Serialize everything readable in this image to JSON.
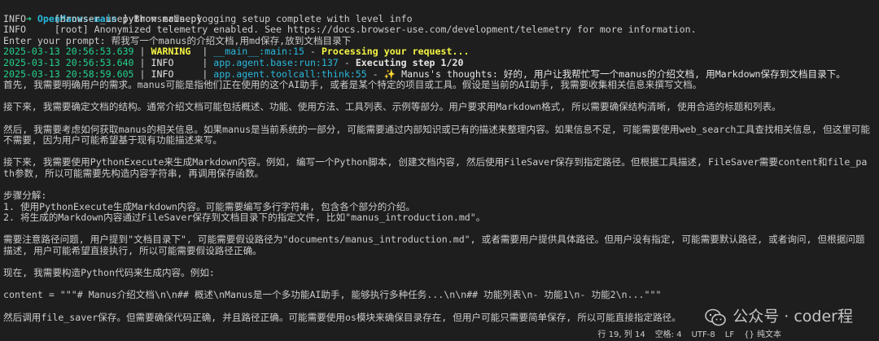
{
  "prompt_line": {
    "arrow": "➜",
    "dir": "OpenManus-main",
    "command": "python main.py"
  },
  "info_lines": [
    "INFO     [browser_use] BrowserUse logging setup complete with level info",
    "INFO     [root] Anonymized telemetry enabled. See https://docs.browser-use.com/development/telemetry for more information.",
    "Enter your prompt: 帮我写一个manus的介绍文档,用md保存,放到文档目录下"
  ],
  "log_lines": [
    {
      "ts": "2025-03-13 20:56:53.639",
      "level": "WARNING ",
      "level_class": "warn",
      "module": "__main__:main:15",
      "dash": " - ",
      "message": "Processing your request...",
      "msg_class": "msg-warn"
    },
    {
      "ts": "2025-03-13 20:56:53.640",
      "level": "INFO    ",
      "level_class": "info",
      "module": "app.agent.base:run:137",
      "dash": " - ",
      "message": "Executing step 1/20",
      "msg_class": "msg-exec"
    },
    {
      "ts": "2025-03-13 20:58:59.605",
      "level": "INFO    ",
      "level_class": "info",
      "module": "app.agent.toolcall:think:55",
      "dash": " - ",
      "message": "✨ Manus's thoughts: 好的, 用户让我帮忙写一个manus的介绍文档, 用Markdown保存到文档目录下。",
      "msg_class": "msg-think"
    }
  ],
  "paragraphs": [
    "首先, 我需要明确用户的需求。manus可能是指他们正在使用的这个AI助手, 或者是某个特定的项目或工具。假设是当前的AI助手, 我需要收集相关信息来撰写文档。",
    "",
    "接下来, 我需要确定文档的结构。通常介绍文档可能包括概述、功能、使用方法、工具列表、示例等部分。用户要求用Markdown格式, 所以需要确保结构清晰, 使用合适的标题和列表。",
    "",
    "然后, 我需要考虑如何获取manus的相关信息。如果manus是当前系统的一部分, 可能需要通过内部知识或已有的描述来整理内容。如果信息不足, 可能需要使用web_search工具查找相关信息, 但这里可能不需要, 因为用户可能希望基于现有功能描述来写。",
    "",
    "接下来, 我需要使用PythonExecute来生成Markdown内容。例如, 编写一个Python脚本, 创建文档内容, 然后使用FileSaver保存到指定路径。但根据工具描述, FileSaver需要content和file_path参数, 所以可能需要先构造内容字符串, 再调用保存函数。",
    "",
    "步骤分解:",
    "1. 使用PythonExecute生成Markdown内容。可能需要编写多行字符串, 包含各个部分的介绍。",
    "2. 将生成的Markdown内容通过FileSaver保存到文档目录下的指定文件, 比如\"manus_introduction.md\"。",
    "",
    "需要注意路径问题, 用户提到\"文档目录下\", 可能需要假设路径为\"documents/manus_introduction.md\", 或者需要用户提供具体路径。但用户没有指定, 可能需要默认路径, 或者询问, 但根据问题描述, 用户可能希望直接执行, 所以可能需要假设路径正确。",
    "",
    "现在, 我需要构造Python代码来生成内容。例如:",
    "",
    "content = \"\"\"# Manus介绍文档\\n\\n## 概述\\nManus是一个多功能AI助手, 能够执行多种任务...\\n\\n## 功能列表\\n- 功能1\\n- 功能2\\n...\"\"\"",
    "",
    "然后调用file_saver保存。但需要确保代码正确, 并且路径正确。可能需要使用os模块来确保目录存在, 但用户可能只需要简单保存, 所以可能直接指定路径。"
  ],
  "statusbar": {
    "line_col": "行 19, 列 14",
    "spaces": "空格: 4",
    "encoding": "UTF-8",
    "eol": "LF",
    "lang": "{} 纯文本"
  },
  "watermark": {
    "icon": "wechat-icon",
    "text": "公众号 · coder程"
  }
}
